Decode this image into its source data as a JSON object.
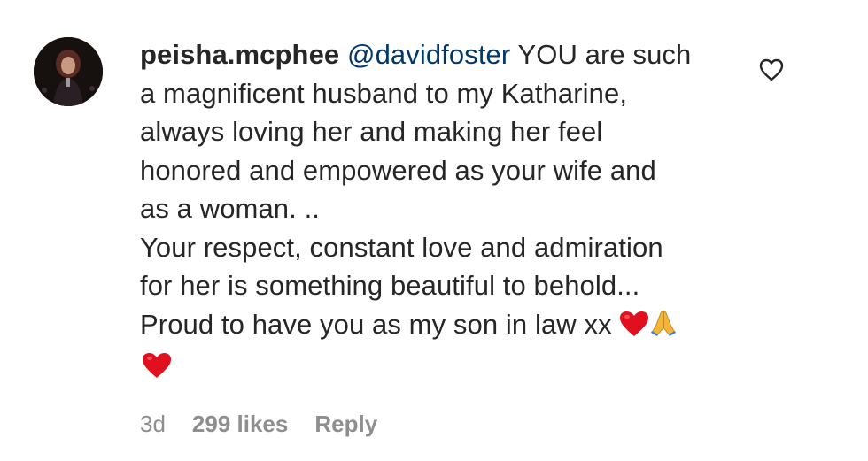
{
  "comment": {
    "username": "peisha.mcphee",
    "mention": "@davidfoster",
    "first_line_text": " YOU are such",
    "lines": [
      "a magnificent husband to my Katharine,",
      "always loving her and making her feel",
      "honored and empowered as your wife and",
      "as a woman. ..",
      "Your respect, constant love and admiration",
      "for her is something beautiful to behold...",
      "Proud to have you as my son in law xx "
    ],
    "emojis": [
      "red-heart",
      "folded-hands",
      "red-heart"
    ],
    "time": "3d",
    "likes": "299 likes",
    "reply_label": "Reply",
    "like_icon": "heart-outline-icon"
  },
  "colors": {
    "text": "#262626",
    "mention": "#00376b",
    "meta": "#8e8e8e",
    "heart": "#e0101e"
  }
}
